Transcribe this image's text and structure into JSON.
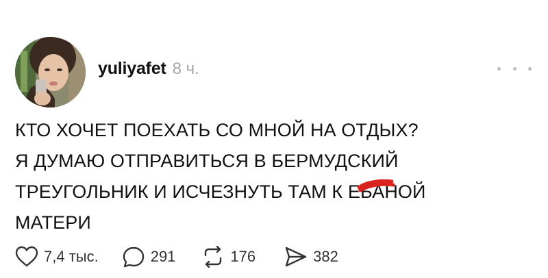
{
  "post": {
    "author": {
      "username": "yuliyafet",
      "time_ago": "8 ч."
    },
    "text_lines": [
      "КТО ХОЧЕТ ПОЕХАТЬ СО МНОЙ НА ОТДЫХ?",
      "Я ДУМАЮ ОТПРАВИТЬСЯ В БЕРМУДСКИЙ",
      "ТРЕУГОЛЬНИК И ИСЧЕЗНУТЬ ТАМ К Е",
      "НОЙ",
      "МАТЕРИ"
    ],
    "redacted_text": "БА",
    "actions": {
      "likes": "7,4 тыс.",
      "replies": "291",
      "reposts": "176",
      "shares": "382"
    },
    "icons": {
      "like": "heart-icon",
      "reply": "comment-bubble-icon",
      "repost": "repost-arrows-icon",
      "share": "send-icon",
      "more": "more-dots-icon"
    },
    "colors": {
      "text": "#111111",
      "timestamp": "#a6a6a6",
      "icon": "#333333",
      "censor_mark": "#d8231f"
    }
  }
}
